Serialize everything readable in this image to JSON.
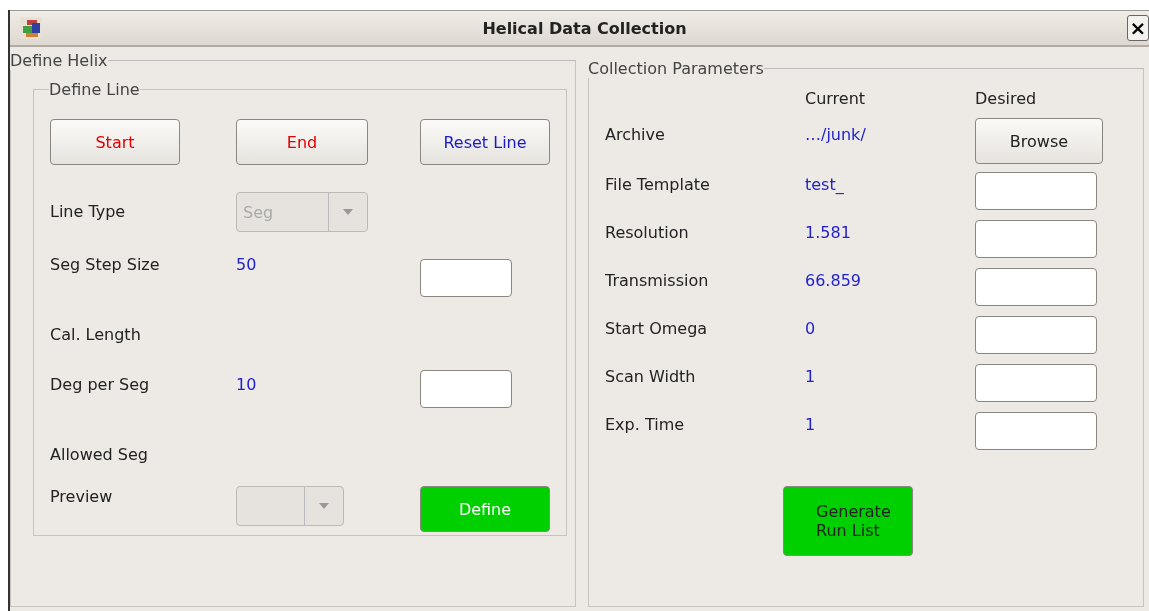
{
  "window": {
    "title": "Helical Data Collection",
    "close": "×"
  },
  "define_helix": {
    "title": "Define Helix",
    "define_line": {
      "title": "Define Line",
      "buttons": [
        {
          "label": "Start",
          "color": "#e00000"
        },
        {
          "label": "End",
          "color": "#e00000"
        },
        {
          "label": "Reset Line",
          "color": "#1a1acc"
        }
      ],
      "rows": [
        {
          "kind": "combo",
          "label": "Line Type",
          "value": "Seg",
          "disabled": true
        },
        {
          "kind": "value",
          "label": "Seg Step Size",
          "current": "50"
        },
        {
          "kind": "label",
          "label": "Cal. Length"
        },
        {
          "kind": "value",
          "label": "Deg per Seg",
          "current": "10"
        },
        {
          "kind": "label",
          "label": "Allowed Seg"
        },
        {
          "kind": "combo-action",
          "label": "Preview",
          "disabled": true,
          "action": "Define"
        }
      ]
    }
  },
  "collection_parameters": {
    "title": "Collection Parameters",
    "headers": [
      "Current",
      "Desired"
    ],
    "rows": [
      {
        "kind": "browse",
        "label": "Archive",
        "current": "…/junk/",
        "button": "Browse"
      },
      {
        "kind": "field",
        "label": "File Template",
        "current": "test_"
      },
      {
        "kind": "field",
        "label": "Resolution",
        "current": "1.581"
      },
      {
        "kind": "field",
        "label": "Transmission",
        "current": "66.859"
      },
      {
        "kind": "field",
        "label": "Start Omega",
        "current": "0"
      },
      {
        "kind": "field",
        "label": "Scan Width",
        "current": "1"
      },
      {
        "kind": "field",
        "label": "Exp. Time",
        "current": "1"
      }
    ],
    "action": "Generate Run List"
  }
}
